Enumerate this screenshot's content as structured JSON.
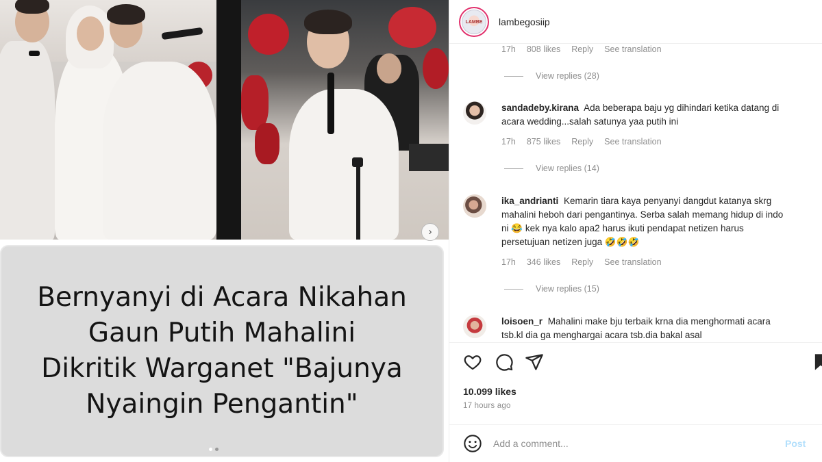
{
  "header": {
    "username": "lambegosiip",
    "avatar_text": "LAMBE"
  },
  "media": {
    "caption_lines": [
      "Bernyanyi di Acara Nikahan",
      "Gaun Putih Mahalini",
      "Dikritik Warganet \"Bajunya",
      "Nyaingin Pengantin\""
    ],
    "next_arrow": "›"
  },
  "comments": {
    "top_meta": {
      "time": "17h",
      "likes": "808 likes",
      "reply": "Reply",
      "translate": "See translation"
    },
    "top_view_replies": "View replies (28)",
    "items": [
      {
        "username": "sandadeby.kirana",
        "text": "Ada beberapa baju yg dihindari ketika datang di acara wedding...salah satunya yaa putih ini",
        "time": "17h",
        "likes": "875 likes",
        "reply": "Reply",
        "translate": "See translation",
        "view_replies": "View replies (14)"
      },
      {
        "username": "ika_andrianti",
        "text": "Kemarin tiara kaya penyanyi dangdut katanya skrg mahalini heboh dari pengantinya. Serba salah memang hidup di indo ni 😂 kek nya kalo apa2 harus ikuti pendapat netizen harus persetujuan netizen juga 🤣🤣🤣",
        "time": "17h",
        "likes": "346 likes",
        "reply": "Reply",
        "translate": "See translation",
        "view_replies": "View replies (15)"
      },
      {
        "username": "loisoen_r",
        "text": "Mahalini make bju terbaik krna dia menghormati acara tsb.kl dia ga menghargai acara tsb.dia bakal asal"
      }
    ]
  },
  "actions": {
    "likes": "10.099 likes",
    "time_ago": "17 hours ago"
  },
  "add_comment": {
    "placeholder": "Add a comment...",
    "post_label": "Post"
  },
  "colors": {
    "accent_blue": "#b2dffc",
    "text_primary": "#262626",
    "text_secondary": "#8e8e8e",
    "caption_bg": "#dcdcdc"
  }
}
